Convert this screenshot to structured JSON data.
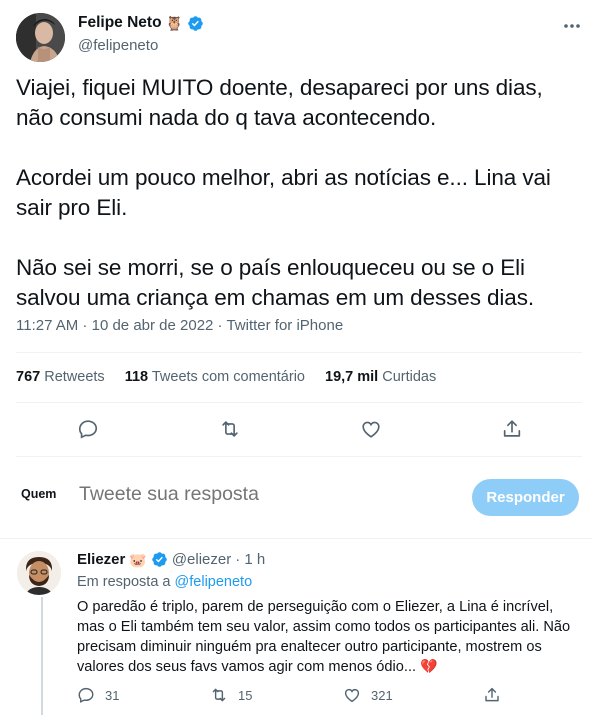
{
  "tweet": {
    "author_name": "Felipe Neto",
    "author_emoji": "🦉",
    "author_handle": "@felipeneto",
    "paragraphs": [
      "Viajei, fiquei MUITO doente, desapareci por uns dias, não consumi nada do q tava acontecendo.",
      "Acordei um pouco melhor, abri as notícias e... Lina vai sair pro Eli.",
      "Não sei se morri, se o país enlouqueceu ou se o Eli salvou uma criança em chamas em um desses dias."
    ],
    "time": "11:27 AM",
    "date": "10 de abr de 2022",
    "source": "Twitter for iPhone",
    "separator": " · "
  },
  "stats": {
    "retweets_count": "767",
    "retweets_label": "Retweets",
    "quotes_count": "118",
    "quotes_label": "Tweets com comentário",
    "likes_count": "19,7 mil",
    "likes_label": "Curtidas"
  },
  "compose": {
    "who_label": "Quem",
    "placeholder": "Tweete sua resposta",
    "button_label": "Responder"
  },
  "reply": {
    "author_name": "Eliezer",
    "author_emoji": "🐷",
    "author_handle": "@eliezer",
    "time_ago": "· 1 h",
    "replying_prefix": "Em resposta a",
    "replying_handle": "@felipeneto",
    "text": "O paredão é triplo, parem de perseguição com o Eliezer, a Lina é incrível, mas o Eli também tem seu valor, assim como todos os participantes ali. Não precisam diminuir ninguém pra enaltecer outro participante, mostrem os valores dos seus favs vamos agir com menos ódio...",
    "text_emoji": "💔",
    "reply_count": "31",
    "retweet_count": "15",
    "like_count": "321"
  },
  "colors": {
    "accent": "#1d9bf0",
    "secondary_text": "#536471",
    "disabled_button": "#8ecdf8"
  }
}
